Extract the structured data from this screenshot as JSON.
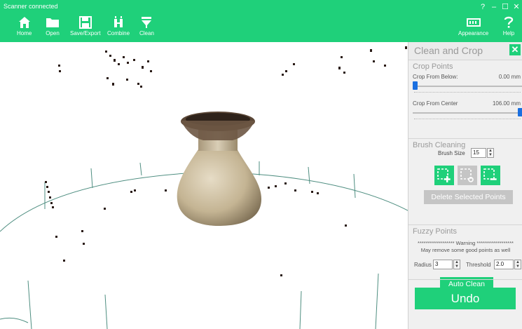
{
  "app": {
    "status": "Scanner connected",
    "window_controls": [
      "?",
      "–",
      "☐",
      "✕"
    ]
  },
  "toolbar": {
    "left": [
      {
        "label": "Home",
        "icon": "home-icon"
      },
      {
        "label": "Open",
        "icon": "folder-icon"
      },
      {
        "label": "Save/Export",
        "icon": "save-icon"
      },
      {
        "label": "Combine",
        "icon": "combine-icon"
      },
      {
        "label": "Clean",
        "icon": "funnel-icon"
      }
    ],
    "right": [
      {
        "label": "Appearance",
        "icon": "appearance-icon"
      },
      {
        "label": "Help",
        "icon": "help-icon"
      }
    ]
  },
  "panel": {
    "title": "Clean and Crop",
    "crop_points": {
      "title": "Crop Points",
      "from_below": {
        "label": "Crop From Below:",
        "value": "0.00 mm",
        "level": 0.0
      },
      "from_center": {
        "label": "Crop From Center",
        "value": "106.00 mm",
        "level": 1.0
      }
    },
    "brush": {
      "title": "Brush Cleaning",
      "size_label": "Brush Size",
      "size_value": "15",
      "delete_label": "Delete Selected Points"
    },
    "fuzzy": {
      "title": "Fuzzy Points",
      "warning_line1": "****************** Warning ******************",
      "warning_line2": "May remove some good points as well",
      "radius_label": "Radius",
      "radius_value": "3",
      "threshold_label": "Threshold",
      "threshold_value": "2.0",
      "auto_clean_label": "Auto Clean"
    },
    "undo_label": "Undo"
  },
  "colors": {
    "accent": "#1fd07a",
    "slider_thumb": "#1a6fe0",
    "disabled_button": "#c5c5c5"
  }
}
